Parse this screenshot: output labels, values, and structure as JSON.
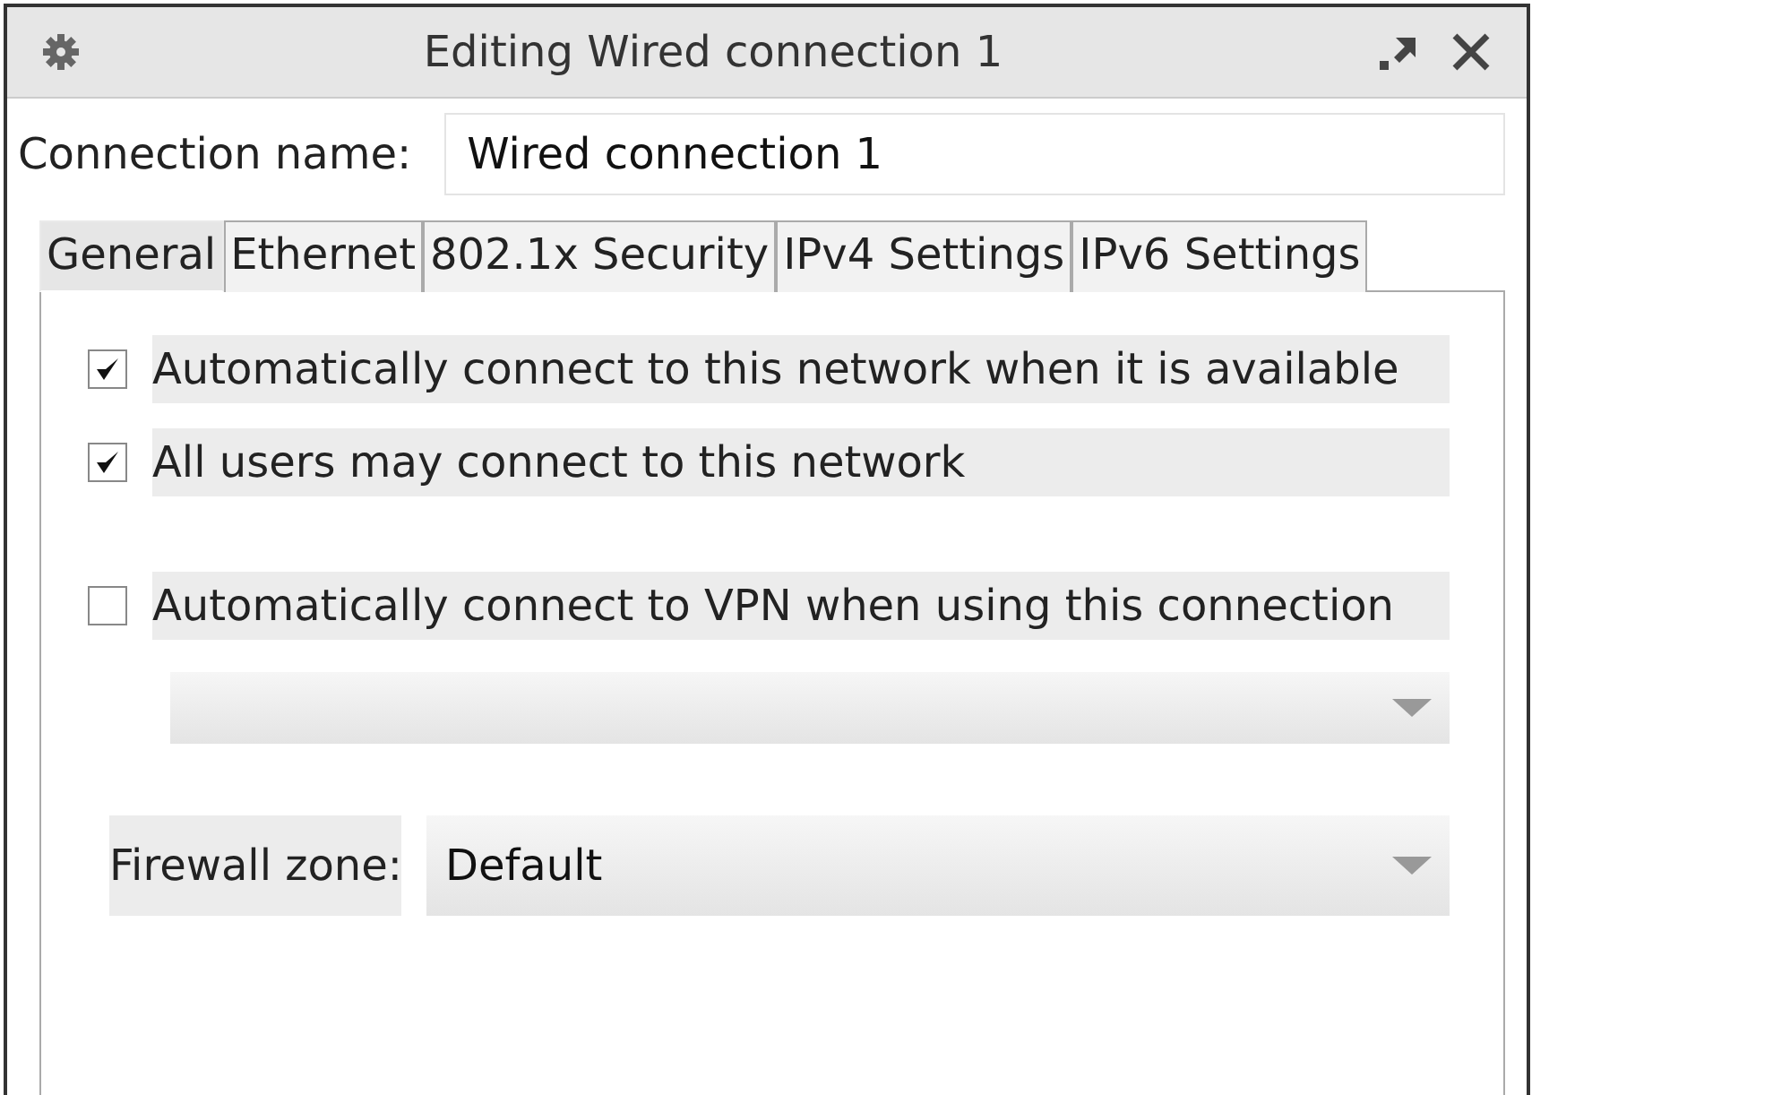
{
  "window": {
    "title": "Editing Wired connection 1"
  },
  "connection_name": {
    "label": "Connection name:",
    "value": "Wired connection 1"
  },
  "tabs": [
    {
      "label": "General",
      "selected": true
    },
    {
      "label": "Ethernet",
      "selected": false
    },
    {
      "label": "802.1x Security",
      "selected": false
    },
    {
      "label": "IPv4 Settings",
      "selected": false
    },
    {
      "label": "IPv6 Settings",
      "selected": false
    }
  ],
  "options": [
    {
      "label": "Automatically connect to this network when it is available",
      "checked": true
    },
    {
      "label": "All users may connect to this network",
      "checked": true
    },
    {
      "label": "Automatically connect to VPN when using this connection",
      "checked": false
    }
  ],
  "firewall_zone": {
    "label": "Firewall zone:",
    "value": "Default"
  }
}
